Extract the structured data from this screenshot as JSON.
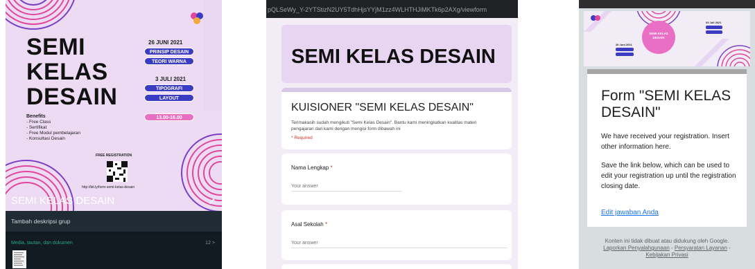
{
  "whatsapp": {
    "poster": {
      "title_lines": [
        "SEMI",
        "KELAS",
        "DESAIN"
      ],
      "date1": "26 JUNI 2021",
      "topics1": [
        "PRINSIP DESAIN",
        "TEORI WARNA"
      ],
      "date2": "3 JULI 2021",
      "topics2": [
        "TIPOGRAFI",
        "LAYOUT"
      ],
      "time": "13.00-16.00",
      "benefits_title": "Benefits",
      "benefits": [
        "- Free Class",
        "- Sertifikat",
        "- Free Modul pembelajaran",
        "- Konsultasi Desain"
      ],
      "free_registration": "FREE REGISTRATION",
      "url": "http://bit.ly/form-semi-kelas-desain"
    },
    "group_name": "SEMI KELAS DESAIN",
    "description_placeholder": "Tambah deskripsi grup",
    "media_label": "Media, tautan, dan dokumen",
    "media_count": "12 >"
  },
  "form": {
    "url_fragment": "pQLSeWy_Y-2YTStizN2UY5TdhHjsYYjM1zz4WLHTHJiMKTk6p2AXg/viewform",
    "header_title": "SEMI KELAS DESAIN",
    "form_title": "KUISIONER \"SEMI KELAS DESAIN\"",
    "form_description": "Terimakasih sudah mengikuti \"Semi Kelas Desain\". Bantu kami meningkatkan kualitas materi pengajaran dari kami dengan mengisi form dibawah ini",
    "required_note": "* Required",
    "questions": [
      {
        "label": "Nama Lengkap",
        "required": "*",
        "placeholder": "Your answer"
      },
      {
        "label": "Asal Sekolah",
        "required": "*",
        "placeholder": "Your answer"
      }
    ]
  },
  "confirmation": {
    "banner": {
      "title": "SEMI KELAS DESAIN",
      "date1": "26 Juni 2021",
      "date2": "03 Juli 2021"
    },
    "title": "Form \"SEMI KELAS DESAIN\"",
    "message": "We have received your registration. Insert other information here.",
    "save_note": "Save the link below, which can be used to edit your registration up until the registration closing date.",
    "edit_link": "Edit jawaban Anda",
    "footer_text": "Konten ini tidak dibuat atau didukung oleh Google.",
    "footer_links": [
      "Laporkan Penyalahgunaan",
      "Persyaratan Layanan",
      "Kebijakan Privasi"
    ],
    "footer_sep": " - "
  },
  "colors": {
    "whatsapp_bg": "#0f1a1f",
    "accent_green": "#25a884",
    "poster_bg": "#ecdbf3",
    "pill_blue": "#3b3cc4",
    "pill_pink": "#e86fc4",
    "form_bg": "#f2ecf7",
    "link_blue": "#1a73e8",
    "required_red": "#d93025"
  },
  "icons": [
    "edit-pencil-icon",
    "qr-code-icon",
    "brand-logo-icon",
    "file-thumbnail-icon"
  ]
}
